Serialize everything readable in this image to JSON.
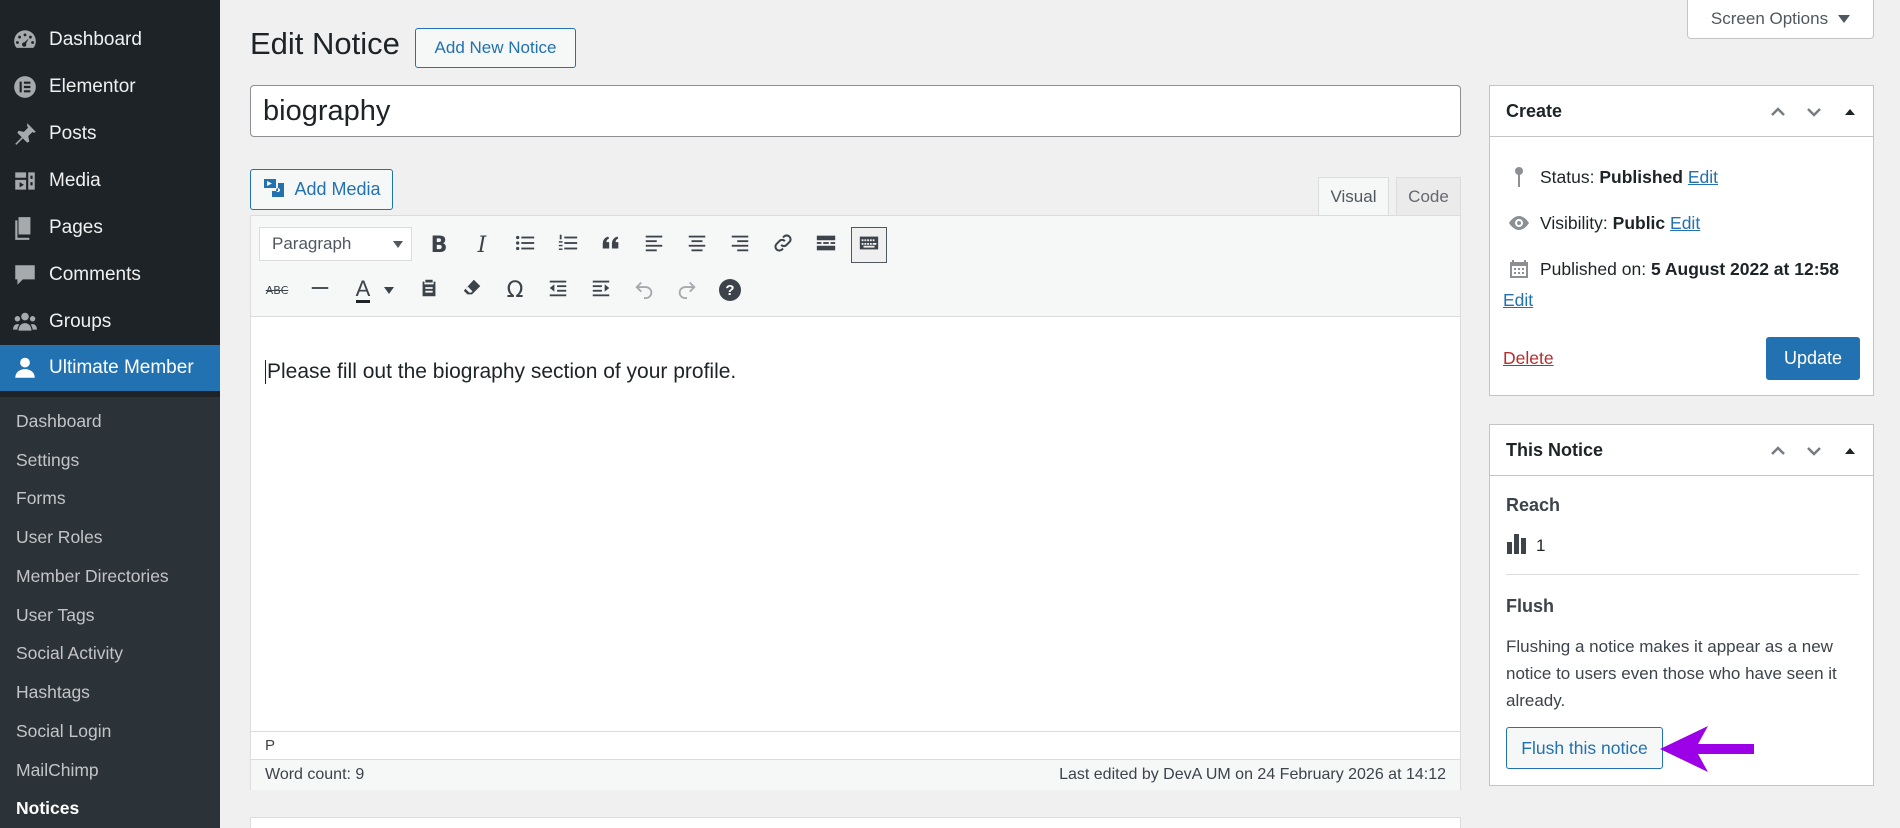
{
  "sidebar": {
    "items": [
      {
        "label": "Dashboard",
        "icon": "dashboard-icon"
      },
      {
        "label": "Elementor",
        "icon": "elementor-icon"
      },
      {
        "label": "Posts",
        "icon": "pin-icon"
      },
      {
        "label": "Media",
        "icon": "media-icon"
      },
      {
        "label": "Pages",
        "icon": "pages-icon"
      },
      {
        "label": "Comments",
        "icon": "comments-icon"
      },
      {
        "label": "Groups",
        "icon": "groups-icon"
      },
      {
        "label": "Ultimate Member",
        "icon": "user-icon"
      }
    ],
    "submenu": [
      "Dashboard",
      "Settings",
      "Forms",
      "User Roles",
      "Member Directories",
      "User Tags",
      "Social Activity",
      "Hashtags",
      "Social Login",
      "MailChimp",
      "Notices"
    ]
  },
  "header": {
    "title": "Edit Notice",
    "add_new_label": "Add New Notice",
    "screen_options_label": "Screen Options"
  },
  "post": {
    "title": "biography"
  },
  "editor": {
    "add_media_label": "Add Media",
    "tab_visual": "Visual",
    "tab_code": "Code",
    "format_value": "Paragraph",
    "text_color_glyph": "A",
    "content": "Please fill out the biography section of your profile.",
    "path": "P",
    "word_count": "Word count: 9",
    "last_edited": "Last edited by DevA UM on 24 February 2026 at 14:12"
  },
  "create_box": {
    "title": "Create",
    "status_label": "Status:",
    "status_value": "Published",
    "visibility_label": "Visibility:",
    "visibility_value": "Public",
    "published_label": "Published on:",
    "published_value": "5 August 2022 at 12:58",
    "edit_label": "Edit",
    "delete_label": "Delete",
    "update_label": "Update"
  },
  "notice_box": {
    "title": "This Notice",
    "reach_label": "Reach",
    "reach_value": "1",
    "flush_label": "Flush",
    "flush_description": "Flushing a notice makes it appear as a new notice to users even those who have seen it already.",
    "flush_button_label": "Flush this notice"
  },
  "colors": {
    "admin_bar": "#1d2327",
    "accent": "#2271b1",
    "annotation_arrow": "#9b00e6",
    "delete": "#b32d2e"
  }
}
